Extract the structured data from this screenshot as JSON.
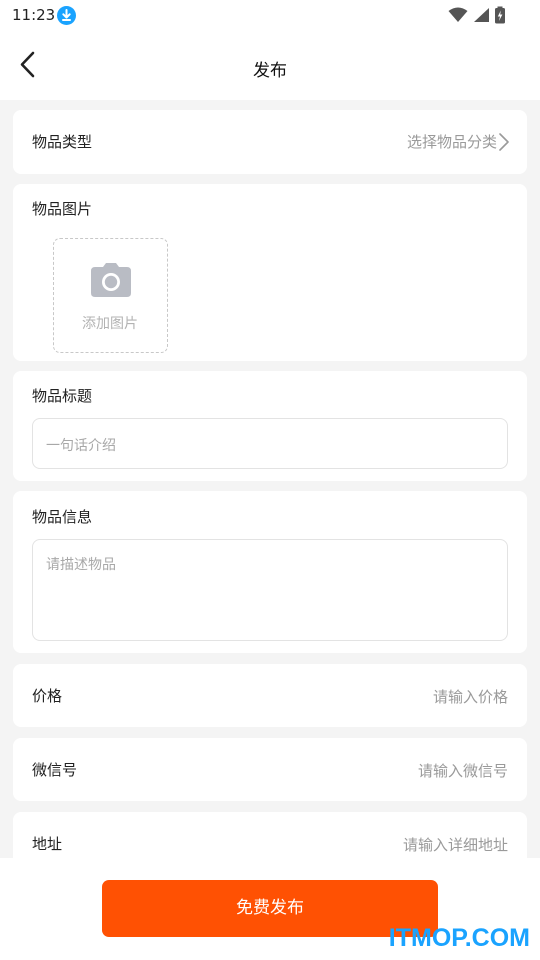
{
  "status_bar": {
    "time": "11:23"
  },
  "header": {
    "title": "发布"
  },
  "form": {
    "category": {
      "label": "物品类型",
      "hint": "选择物品分类"
    },
    "images": {
      "label": "物品图片",
      "add_label": "添加图片"
    },
    "title": {
      "label": "物品标题",
      "placeholder": "一句话介绍"
    },
    "info": {
      "label": "物品信息",
      "placeholder": "请描述物品"
    },
    "price": {
      "label": "价格",
      "placeholder": "请输入价格"
    },
    "wechat": {
      "label": "微信号",
      "placeholder": "请输入微信号"
    },
    "address": {
      "label": "地址",
      "placeholder": "请输入详细地址"
    }
  },
  "submit_label": "免费发布",
  "watermark": "ITMOP.COM",
  "colors": {
    "accent": "#ff5103",
    "background": "#f4f4f4",
    "watermark": "#1aa3ff"
  }
}
